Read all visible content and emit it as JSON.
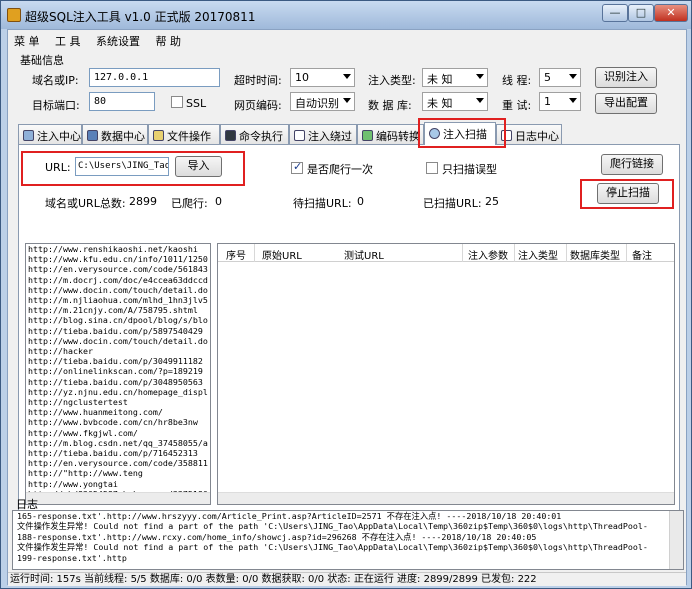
{
  "window": {
    "title": "超级SQL注入工具 v1.0 正式版 20170811",
    "minimize": "—",
    "maximize": "□",
    "close": "✕"
  },
  "menu": [
    "菜 单",
    "工 具",
    "系统设置",
    "帮 助"
  ],
  "basic": {
    "group": "基础信息",
    "domain_label": "域名或IP:",
    "domain_value": "127.0.0.1",
    "port_label": "目标端口:",
    "port_value": "80",
    "ssl_label": "SSL",
    "timeout_label": "超时时间:",
    "timeout_value": "10",
    "encoding_label": "网页编码:",
    "encoding_value": "自动识别",
    "inject_type_label": "注入类型:",
    "inject_type_value": "未 知",
    "db_label": "数 据 库:",
    "db_value": "未 知",
    "threads_label": "线 程:",
    "threads_value": "5",
    "retry_label": "重 试:",
    "retry_value": "1",
    "identify_button": "识别注入",
    "export_button": "导出配置"
  },
  "tabs": [
    {
      "label": "注入中心",
      "icon": "gear-icon"
    },
    {
      "label": "数据中心",
      "icon": "database-icon"
    },
    {
      "label": "文件操作",
      "icon": "folder-icon"
    },
    {
      "label": "命令执行",
      "icon": "terminal-icon"
    },
    {
      "label": "注入绕过",
      "icon": "bypass-icon"
    },
    {
      "label": "编码转换",
      "icon": "encode-icon"
    },
    {
      "label": "注入扫描",
      "icon": "scan-icon"
    },
    {
      "label": "日志中心",
      "icon": "log-icon"
    }
  ],
  "scan": {
    "url_label": "URL:",
    "url_value": "C:\\Users\\JING_Tao\\",
    "import_button": "导入",
    "crawl_checkbox": "是否爬行一次",
    "crawl_checked": true,
    "scan_only_checkbox": "只扫描误型",
    "scan_only_checked": false,
    "crawl_links_button": "爬行链接",
    "stop_scan_button": "停止扫描",
    "total_label": "域名或URL总数:",
    "total_value": "2899",
    "crawled_label": "已爬行:",
    "crawled_value": "0",
    "pending_label": "待扫描URL:",
    "pending_value": "0",
    "scanned_label": "已扫描URL:",
    "scanned_value": "25"
  },
  "url_list": [
    "http://www.renshikaoshi.net/kaoshi",
    "http://www.kfu.edu.cn/info/1011/1250",
    "http://en.verysource.com/code/561843",
    "http://m.docrj.com/doc/e4ccea63ddccd",
    "http://www.docin.com/touch/detail.do",
    "http://m.njliaohua.com/mlhd_1hn3jlv5",
    "http://m.21cnjy.com/A/758795.shtml",
    "http://blog.sina.cn/dpool/blog/s/blo",
    "http://tieba.baidu.com/p/5897540429",
    "http://www.docin.com/touch/detail.do",
    "http://hacker",
    "http://tieba.baidu.com/p/3049911182",
    "http://onlinelinkscan.com/?p=189219",
    "http://tieba.baidu.com/p/3048950563",
    "http://yz.njnu.edu.cn/homepage_displ",
    "http://ngclustertest",
    "http://www.huanmeitong.com/",
    "http://www.bvbcode.com/cn/hr8be3nw",
    "http://www.fkgjwl.com/",
    "http://m.blog.csdn.net/qq_37458055/a",
    "http://tieba.baidu.com/p/716452313",
    "http://en.verysource.com/code/358811",
    "http://\"http://www.teng",
    "http://www.yongtai",
    "http://chd82054587.bokee.com/3375180"
  ],
  "results_columns": [
    "序号",
    "原始URL",
    "测试URL",
    "注入参数",
    "注入类型",
    "数据库类型",
    "备注"
  ],
  "log": {
    "title": "日志",
    "lines": [
      "165-response.txt'.http://www.hrszyyy.com/Article_Print.asp?ArticleID=2571 不存在注入点! ----2018/10/18 20:40:01",
      "文件操作发生异常! Could not find a part of the path 'C:\\Users\\JING_Tao\\AppData\\Local\\Temp\\360zip$Temp\\360$0\\logs\\http\\ThreadPool-",
      "188-response.txt'.http://www.rcxy.com/home_info/showcj.asp?id=296268 不存在注入点! ----2018/10/18 20:40:05",
      "文件操作发生异常! Could not find a part of the path 'C:\\Users\\JING_Tao\\AppData\\Local\\Temp\\360zip$Temp\\360$0\\logs\\http\\ThreadPool-",
      "199-response.txt'.http"
    ]
  },
  "status": "运行时间: 157s 当前线程: 5/5 数据库: 0/0 表数量: 0/0 数据获取: 0/0 状态: 正在运行 进度: 2899/2899 已发包: 222",
  "colors": {
    "highlight": "#e02020",
    "title_bg": "#9fb9da"
  }
}
